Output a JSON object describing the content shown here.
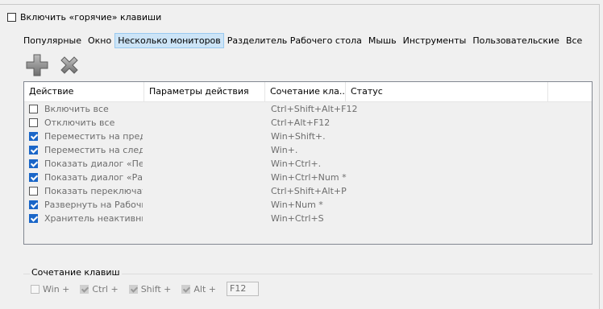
{
  "enable_hotkeys": {
    "label": "Включить «горячие» клавиши",
    "checked": false
  },
  "tabs": [
    {
      "label": "Популярные",
      "selected": false
    },
    {
      "label": "Окно",
      "selected": false
    },
    {
      "label": "Несколько мониторов",
      "selected": true
    },
    {
      "label": "Разделитель Рабочего стола",
      "selected": false
    },
    {
      "label": "Мышь",
      "selected": false
    },
    {
      "label": "Инструменты",
      "selected": false
    },
    {
      "label": "Пользовательские",
      "selected": false
    },
    {
      "label": "Все",
      "selected": false
    }
  ],
  "toolbar": {
    "add_icon": "plus-icon",
    "remove_icon": "x-icon",
    "add_color": "#8a8a8a",
    "remove_color": "#8a8a8a"
  },
  "grid": {
    "columns": [
      "Действие",
      "Параметры действия",
      "Сочетание кла...",
      "Статус",
      ""
    ],
    "rows": [
      {
        "checked": false,
        "action": "Включить все",
        "shortcut": "Ctrl+Shift+Alt+F12"
      },
      {
        "checked": false,
        "action": "Отключить все",
        "shortcut": "Ctrl+Alt+F12"
      },
      {
        "checked": true,
        "action": "Переместить на пред...",
        "shortcut": "Win+Shift+."
      },
      {
        "checked": true,
        "action": "Переместить на след...",
        "shortcut": "Win+."
      },
      {
        "checked": true,
        "action": "Показать диалог «Пе...",
        "shortcut": "Win+Ctrl+."
      },
      {
        "checked": true,
        "action": "Показать диалог «Ра...",
        "shortcut": "Win+Ctrl+Num *"
      },
      {
        "checked": false,
        "action": "Показать переключат...",
        "shortcut": "Ctrl+Shift+Alt+P"
      },
      {
        "checked": true,
        "action": "Развернуть на Рабочи...",
        "shortcut": "Win+Num *"
      },
      {
        "checked": true,
        "action": "Хранитель неактивны...",
        "shortcut": "Win+Ctrl+S"
      }
    ]
  },
  "shortcut_group": {
    "title": "Сочетание клавиш",
    "modifiers": [
      {
        "label": "Win +",
        "checked": false
      },
      {
        "label": "Ctrl +",
        "checked": true
      },
      {
        "label": "Shift +",
        "checked": true
      },
      {
        "label": "Alt +",
        "checked": true
      }
    ],
    "key": "F12"
  },
  "colors": {
    "checkbox_checked": "#1a66c8",
    "selected_tab_bg": "#cce4f7",
    "selected_tab_border": "#99c9ef",
    "disabled_text": "#6d6d6d"
  }
}
